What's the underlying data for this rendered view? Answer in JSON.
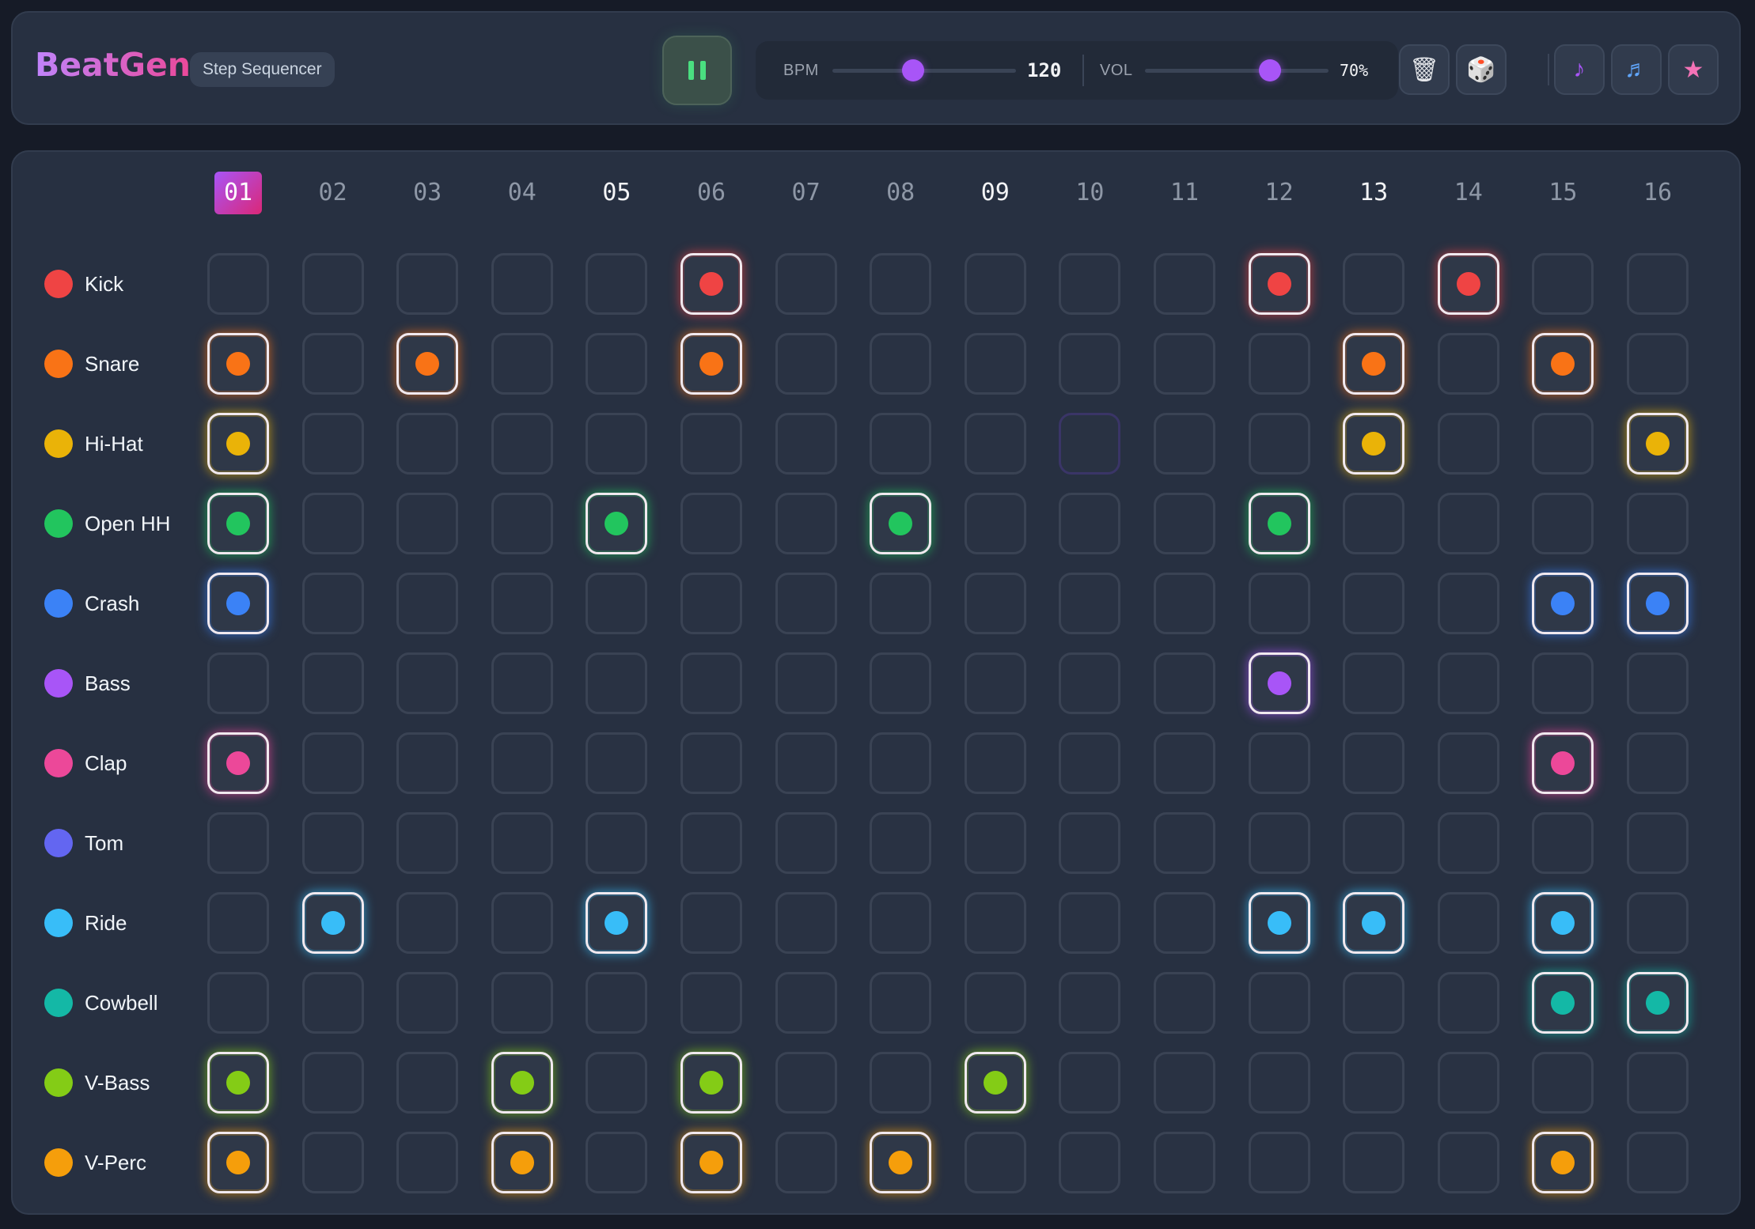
{
  "app": {
    "name": "BeatGen",
    "subtitle": "Step Sequencer"
  },
  "transport": {
    "state": "playing",
    "button_icon": "pause-icon"
  },
  "bpm": {
    "label": "BPM",
    "value": "120",
    "level": 0.44
  },
  "volume": {
    "label": "VOL",
    "value": "70%",
    "level": 0.68
  },
  "toolbar_icons": [
    {
      "name": "trash-icon",
      "glyph": "🗑"
    },
    {
      "name": "dice-icon",
      "glyph": "🎲"
    },
    {
      "name": "note-icon",
      "glyph": "♪",
      "color": "#a855f7"
    },
    {
      "name": "notes-icon",
      "glyph": "♬",
      "color": "#60a5fa"
    },
    {
      "name": "star-icon",
      "glyph": "★",
      "color": "#f472b6"
    }
  ],
  "steps": [
    "01",
    "02",
    "03",
    "04",
    "05",
    "06",
    "07",
    "08",
    "09",
    "10",
    "11",
    "12",
    "13",
    "14",
    "15",
    "16"
  ],
  "current_step": 1,
  "cursor_cell": {
    "track": 2,
    "step": 10
  },
  "tracks": [
    {
      "name": "Kick",
      "color": "#ef4444",
      "active": [
        6,
        12,
        14
      ]
    },
    {
      "name": "Snare",
      "color": "#f97316",
      "active": [
        1,
        3,
        6,
        13,
        15
      ]
    },
    {
      "name": "Hi-Hat",
      "color": "#eab308",
      "active": [
        1,
        13,
        16
      ]
    },
    {
      "name": "Open HH",
      "color": "#22c55e",
      "active": [
        1,
        5,
        8,
        12
      ]
    },
    {
      "name": "Crash",
      "color": "#3b82f6",
      "active": [
        1,
        15,
        16
      ]
    },
    {
      "name": "Bass",
      "color": "#a855f7",
      "active": [
        12
      ]
    },
    {
      "name": "Clap",
      "color": "#ec4899",
      "active": [
        1,
        15
      ]
    },
    {
      "name": "Tom",
      "color": "#6366f1",
      "active": []
    },
    {
      "name": "Ride",
      "color": "#38bdf8",
      "active": [
        2,
        5,
        12,
        13,
        15
      ]
    },
    {
      "name": "Cowbell",
      "color": "#14b8a6",
      "active": [
        15,
        16
      ]
    },
    {
      "name": "V-Bass",
      "color": "#84cc16",
      "active": [
        1,
        4,
        6,
        9
      ]
    },
    {
      "name": "V-Perc",
      "color": "#f59e0b",
      "active": [
        1,
        4,
        6,
        8,
        15
      ]
    }
  ]
}
